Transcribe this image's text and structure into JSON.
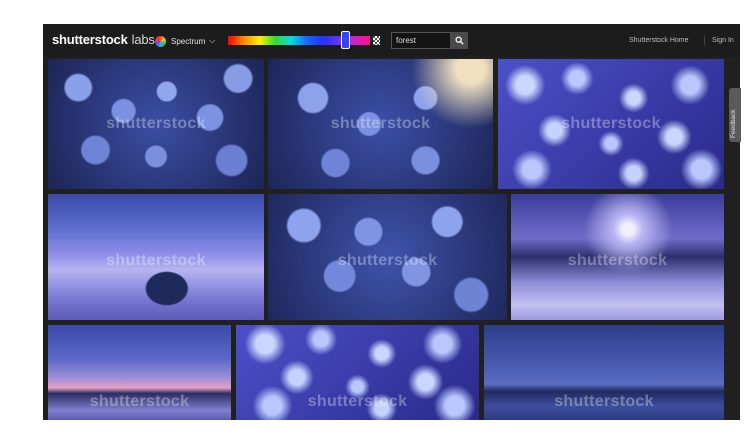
{
  "brand": {
    "name": "shutterstock",
    "suffix": "labs"
  },
  "spectrum": {
    "label": "Spectrum",
    "icon": "color-wheel-icon",
    "chevron": "chevron-down-icon"
  },
  "color_slider": {
    "selected_color": "#3344ff",
    "level": 0.82
  },
  "search": {
    "value": "forest",
    "button_icon": "search-icon"
  },
  "nav": {
    "home": "Shutterstock Home",
    "signin": "Sign In"
  },
  "feedback": {
    "label": "Feedback"
  },
  "tiles": [
    {
      "subject": "blueberries",
      "watermark": "shutterstock"
    },
    {
      "subject": "blueberries",
      "watermark": "shutterstock"
    },
    {
      "subject": "blue flowers",
      "watermark": "shutterstock"
    },
    {
      "subject": "misty lake",
      "watermark": "shutterstock"
    },
    {
      "subject": "blueberries",
      "watermark": "shutterstock"
    },
    {
      "subject": "frozen lake",
      "watermark": "shutterstock"
    },
    {
      "subject": "sunset lake",
      "watermark": "shutterstock"
    },
    {
      "subject": "blue flowers",
      "watermark": "shutterstock"
    },
    {
      "subject": "mountain lake",
      "watermark": "shutterstock"
    }
  ],
  "colors": {
    "topbar": "#1c1c1c",
    "background": "#202020",
    "accent": "#3344ff"
  }
}
